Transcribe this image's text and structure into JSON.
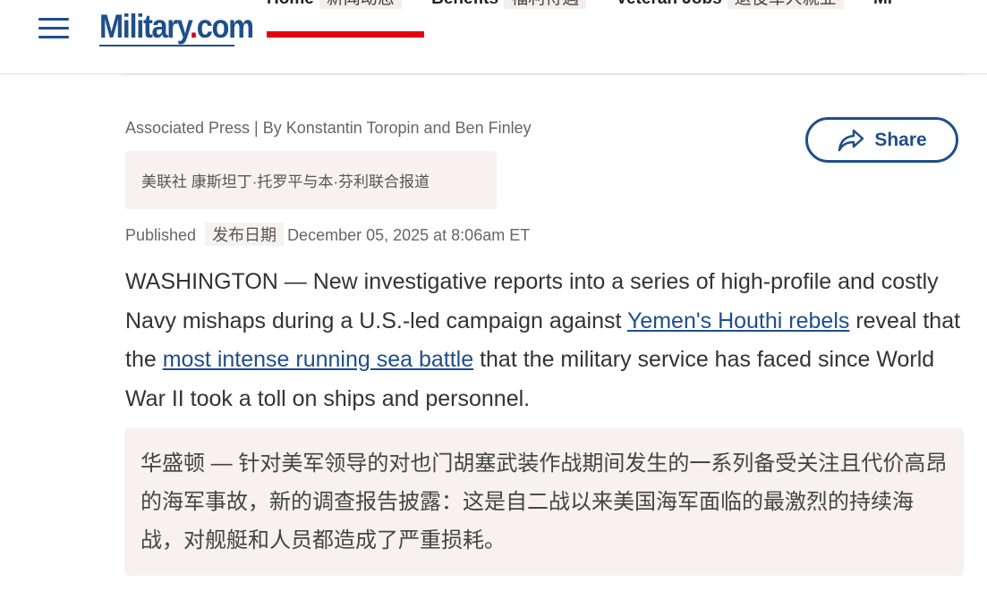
{
  "header": {
    "logo_text_main": "Military",
    "logo_text_dot": ".",
    "logo_text_tld": "com",
    "nav": [
      {
        "label": "Home",
        "translation": "新闻动态"
      },
      {
        "label": "Benefits",
        "translation": "福利待遇"
      },
      {
        "label": "Veteran Jobs",
        "translation": "退役军人就业"
      },
      {
        "label": "Mi"
      }
    ],
    "colors": {
      "brand_blue": "#1f4e8c",
      "active_red": "#e60012",
      "translation_bg": "#f8f1f1"
    }
  },
  "article": {
    "byline": "Associated Press | By Konstantin Toropin and Ben Finley",
    "byline_translation": "美联社 康斯坦丁·托罗平与本·芬利联合报道",
    "published_label": "Published",
    "published_label_translation": "发布日期",
    "published_date": "December 05, 2025 at 8:06am ET",
    "share_label": "Share",
    "paragraph": {
      "part1": "WASHINGTON — New investigative reports into a series of high-profile and costly Navy mishaps during a U.S.-led campaign against ",
      "link1": "Yemen's Houthi rebels",
      "part2": " reveal that the ",
      "link2": "most intense running sea battle",
      "part3": " that the military service has faced since World War II took a toll on ships and personnel."
    },
    "paragraph_translation": "华盛顿 — 针对美军领导的对也门胡塞武装作战期间发生的一系列备受关注且代价高昂的海军事故，新的调查报告披露：这是自二战以来美国海军面临的最激烈的持续海战，对舰艇和人员都造成了严重损耗。"
  }
}
